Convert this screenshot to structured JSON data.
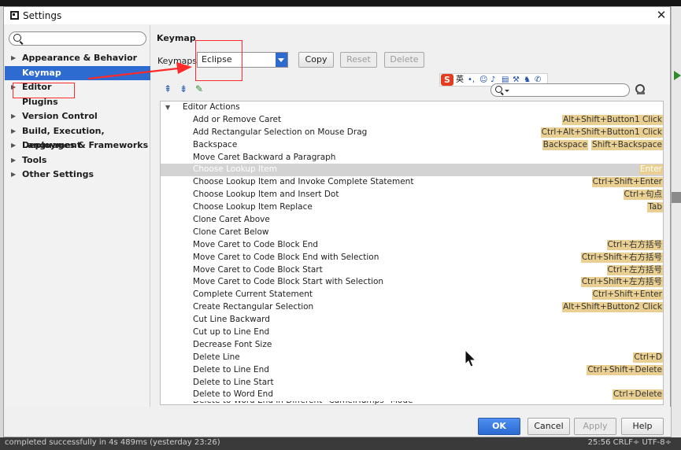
{
  "window": {
    "title": "Settings"
  },
  "sidebar": {
    "items": [
      {
        "label": "Appearance & Behavior",
        "expandable": true
      },
      {
        "label": "Keymap",
        "expandable": false,
        "selected": true
      },
      {
        "label": "Editor",
        "expandable": true
      },
      {
        "label": "Plugins",
        "expandable": false
      },
      {
        "label": "Version Control",
        "expandable": true
      },
      {
        "label": "Build, Execution, Deployment",
        "expandable": true
      },
      {
        "label": "Languages & Frameworks",
        "expandable": true
      },
      {
        "label": "Tools",
        "expandable": true
      },
      {
        "label": "Other Settings",
        "expandable": true
      }
    ]
  },
  "keymap": {
    "title": "Keymap",
    "keymaps_label": "Keymaps:",
    "selected_keymap": "Eclipse",
    "copy_label": "Copy",
    "reset_label": "Reset",
    "delete_label": "Delete"
  },
  "ime": {
    "logo": "S",
    "lang": "英"
  },
  "actions": {
    "group_label": "Editor Actions",
    "rows": [
      {
        "name": "Add or Remove Caret",
        "shortcuts": [
          "Alt+Shift+Button1 Click"
        ]
      },
      {
        "name": "Add Rectangular Selection on Mouse Drag",
        "shortcuts": [
          "Ctrl+Alt+Shift+Button1 Click"
        ]
      },
      {
        "name": "Backspace",
        "shortcuts": [
          "Backspace",
          "Shift+Backspace"
        ]
      },
      {
        "name": "Move Caret Backward a Paragraph",
        "shortcuts": []
      },
      {
        "name": "Choose Lookup Item",
        "shortcuts": [
          "Enter"
        ],
        "selected": true
      },
      {
        "name": "Choose Lookup Item and Invoke Complete Statement",
        "shortcuts": [
          "Ctrl+Shift+Enter"
        ]
      },
      {
        "name": "Choose Lookup Item and Insert Dot",
        "shortcuts": [
          "Ctrl+句点"
        ]
      },
      {
        "name": "Choose Lookup Item Replace",
        "shortcuts": [
          "Tab"
        ]
      },
      {
        "name": "Clone Caret Above",
        "shortcuts": []
      },
      {
        "name": "Clone Caret Below",
        "shortcuts": []
      },
      {
        "name": "Move Caret to Code Block End",
        "shortcuts": [
          "Ctrl+右方括号"
        ]
      },
      {
        "name": "Move Caret to Code Block End with Selection",
        "shortcuts": [
          "Ctrl+Shift+右方括号"
        ]
      },
      {
        "name": "Move Caret to Code Block Start",
        "shortcuts": [
          "Ctrl+左方括号"
        ]
      },
      {
        "name": "Move Caret to Code Block Start with Selection",
        "shortcuts": [
          "Ctrl+Shift+左方括号"
        ]
      },
      {
        "name": "Complete Current Statement",
        "shortcuts": [
          "Ctrl+Shift+Enter"
        ]
      },
      {
        "name": "Create Rectangular Selection",
        "shortcuts": [
          "Alt+Shift+Button2 Click"
        ]
      },
      {
        "name": "Cut Line Backward",
        "shortcuts": []
      },
      {
        "name": "Cut up to Line End",
        "shortcuts": []
      },
      {
        "name": "Decrease Font Size",
        "shortcuts": []
      },
      {
        "name": "Delete Line",
        "shortcuts": [
          "Ctrl+D"
        ]
      },
      {
        "name": "Delete to Line End",
        "shortcuts": [
          "Ctrl+Shift+Delete"
        ]
      },
      {
        "name": "Delete to Line Start",
        "shortcuts": []
      },
      {
        "name": "Delete to Word End",
        "shortcuts": [
          "Ctrl+Delete"
        ]
      },
      {
        "name": "Delete to Word End in Different \"CamelHumps\" Mode",
        "shortcuts": [],
        "cut": true
      }
    ]
  },
  "footer": {
    "ok_label": "OK",
    "cancel_label": "Cancel",
    "apply_label": "Apply",
    "help_label": "Help"
  },
  "background": {
    "status_text": "completed successfully in 4s 489ms (yesterday 23:26)",
    "status_right": "25:56   CRLF÷   UTF-8÷"
  },
  "colors": {
    "selection": "#2e6bd1",
    "annotation": "#ff2a2a",
    "shortcut_badge": "#e9cf91"
  }
}
